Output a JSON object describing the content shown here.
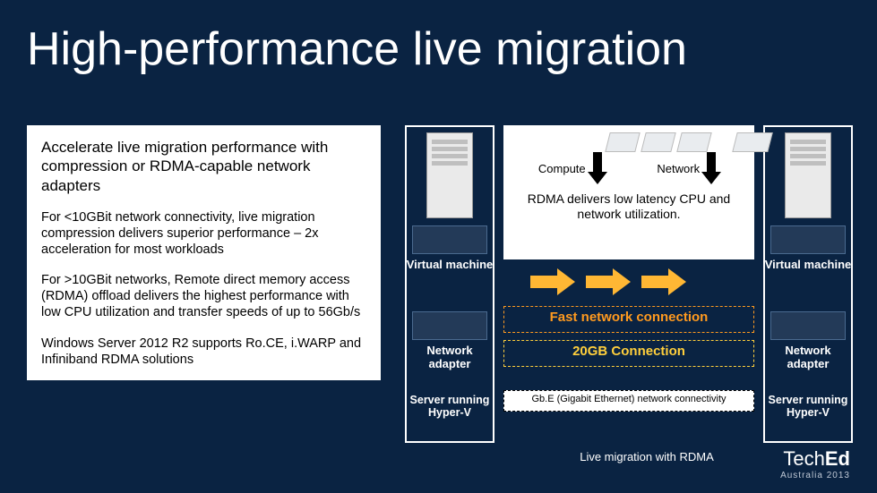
{
  "title": "High-performance live migration",
  "paragraphs": {
    "p1": "Accelerate live migration performance with compression or RDMA-capable network adapters",
    "p2": "For <10GBit network connectivity, live migration compression delivers superior performance – 2x acceleration for most workloads",
    "p3": "For >10GBit networks, Remote direct memory access (RDMA) offload delivers the highest performance with low CPU utilization and transfer speeds of up to 56Gb/s",
    "p4": "Windows Server 2012 R2 supports Ro.CE, i.WARP and Infiniband RDMA solutions"
  },
  "diagram": {
    "compute_label": "Compute",
    "network_label": "Network",
    "rdma_text": "RDMA delivers low latency CPU and network utilization.",
    "vm_label": "Virtual machine",
    "net_adapter_label": "Network adapter",
    "server_label": "Server running Hyper-V",
    "fast_conn": "Fast network connection",
    "gb_conn": "20GB Connection",
    "gbe_line": "Gb.E (Gigabit Ethernet) network connectivity",
    "caption": "Live migration with RDMA"
  },
  "footer": {
    "brand_prefix": "Tech",
    "brand_suffix": "Ed",
    "sub": "Australia 2013"
  }
}
